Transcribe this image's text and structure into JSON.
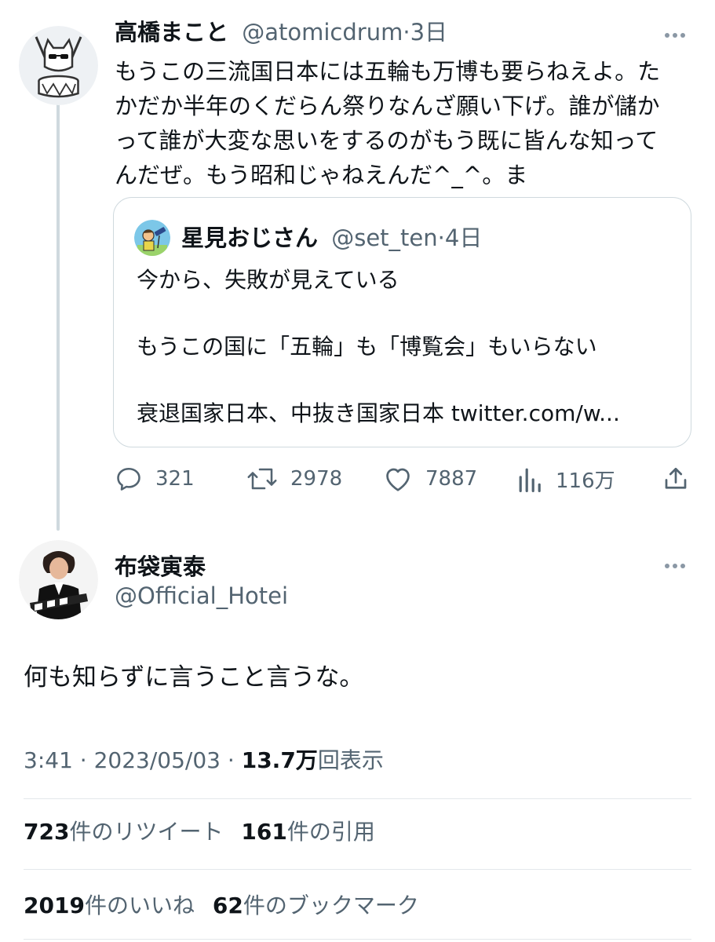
{
  "reply_to": {
    "author_name": "高橋まこと",
    "handle": "@atomicdrum",
    "separator": "·",
    "age": "3日",
    "text_lines": [
      "もうこの三流国日本には五輪も万博も要らねえよ。た",
      "かだか半年のくだらん祭りなんざ願い下げ。誰が儲か",
      "って誰が大変な思いをするのがもう既に皆んな知って",
      "んだぜ。もう昭和じゃねえんだ^_^。ま"
    ],
    "quote": {
      "author_name": "星見おじさん",
      "handle": "@set_ten",
      "separator": "·",
      "age": "4日",
      "line1": "今から、失敗が見えている",
      "line2": "もうこの国に「五輪」も「博覧会」もいらない",
      "line3": "衰退国家日本、中抜き国家日本 twitter.com/w..."
    },
    "actions": {
      "replies": "321",
      "retweets": "2978",
      "likes": "7887",
      "views": "116万"
    }
  },
  "main_tweet": {
    "author_name": "布袋寅泰",
    "handle": "@Official_Hotei",
    "text": "何も知らずに言うこと言うな。",
    "time": "3:41",
    "sep1": "·",
    "date": "2023/05/03",
    "sep2": "·",
    "views_count": "13.7万",
    "views_label": "回表示",
    "retweets_count": "723",
    "retweets_label": "件のリツイート",
    "quotes_count": "161",
    "quotes_label": "件の引用",
    "likes_count": "2019",
    "likes_label": "件のいいね",
    "bookmarks_count": "62",
    "bookmarks_label": "件のブックマーク"
  },
  "icons": {
    "more": "more-horizontal-icon",
    "reply": "reply-bubble-icon",
    "retweet": "retweet-icon",
    "like": "heart-icon",
    "views": "views-bar-chart-icon",
    "share": "share-upload-icon"
  },
  "colors": {
    "text": "#0f1419",
    "muted": "#536471",
    "border": "#cfd9de"
  }
}
